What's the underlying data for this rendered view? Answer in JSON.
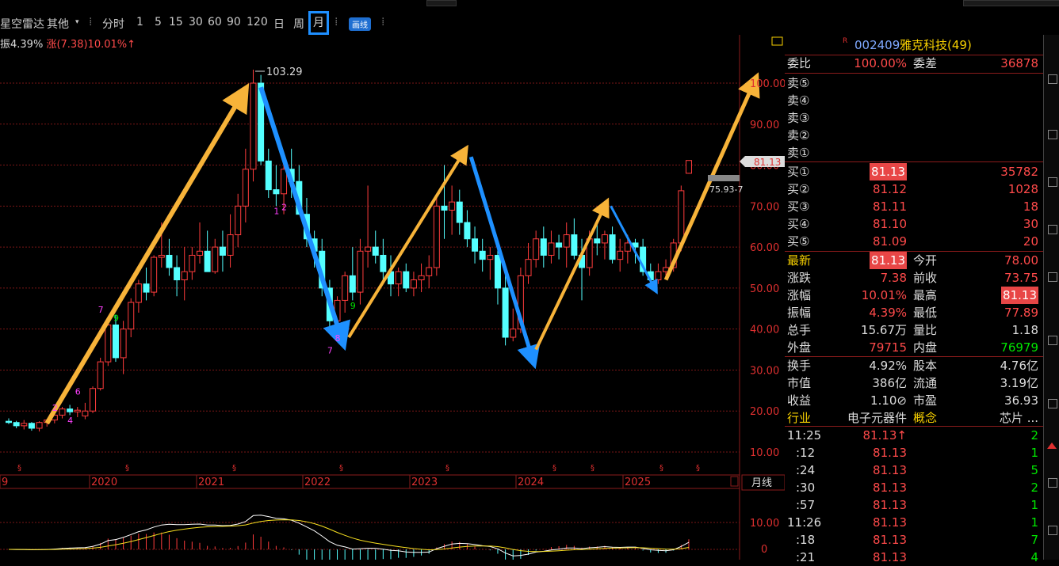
{
  "toolbar": {
    "radar": "星空雷达",
    "other": "其他",
    "timeframes": [
      "分时",
      "1",
      "5",
      "15",
      "30",
      "60",
      "90",
      "120",
      "日",
      "周",
      "月"
    ],
    "selected_timeframe": "月",
    "draw_button": "画线"
  },
  "info_line": {
    "amplitude": "振4.39%",
    "change": "涨(7.38)10.01%↑"
  },
  "stock": {
    "code": "002409",
    "name": "雅克科技(49)",
    "flag": "R"
  },
  "entrust": {
    "ratio_label": "委比",
    "ratio": "100.00%",
    "diff_label": "委差",
    "diff": "36878"
  },
  "sell_levels": [
    "卖⑤",
    "卖④",
    "卖③",
    "卖②",
    "卖①"
  ],
  "buy_levels": [
    {
      "label": "买①",
      "price": "81.13",
      "vol": "35782"
    },
    {
      "label": "买②",
      "price": "81.12",
      "vol": "1028"
    },
    {
      "label": "买③",
      "price": "81.11",
      "vol": "18"
    },
    {
      "label": "买④",
      "price": "81.10",
      "vol": "30"
    },
    {
      "label": "买⑤",
      "price": "81.09",
      "vol": "20"
    }
  ],
  "quote": [
    {
      "l": "最新",
      "v": "81.13",
      "n": "今开",
      "r": "78.00"
    },
    {
      "l": "涨跌",
      "v": "7.38",
      "n": "前收",
      "r": "73.75"
    },
    {
      "l": "涨幅",
      "v": "10.01%",
      "n": "最高",
      "r": "81.13"
    },
    {
      "l": "振幅",
      "v": "4.39%",
      "n": "最低",
      "r": "77.89"
    },
    {
      "l": "总手",
      "v": "15.67万",
      "n": "量比",
      "r": "1.18"
    },
    {
      "l": "外盘",
      "v": "79715",
      "n": "内盘",
      "r": "76979"
    }
  ],
  "fundamentals": [
    {
      "l": "换手",
      "v": "4.92%",
      "n": "股本",
      "r": "4.76亿"
    },
    {
      "l": "市值",
      "v": "386亿",
      "n": "流通",
      "r": "3.19亿"
    },
    {
      "l": "收益",
      "v": "1.10⊘",
      "n": "市盈",
      "r": "36.93"
    },
    {
      "l": "行业",
      "v": "电子元器件",
      "n": "概念",
      "r": "芯片 ..."
    }
  ],
  "ticks": [
    {
      "t": "11:25",
      "p": "81.13↑",
      "v": "2"
    },
    {
      "t": ":12",
      "p": "81.13",
      "v": "1"
    },
    {
      "t": ":24",
      "p": "81.13",
      "v": "5"
    },
    {
      "t": ":30",
      "p": "81.13",
      "v": "2"
    },
    {
      "t": ":57",
      "p": "81.13",
      "v": "1"
    },
    {
      "t": "11:26",
      "p": "81.13",
      "v": "1"
    },
    {
      "t": ":18",
      "p": "81.13",
      "v": "7"
    },
    {
      "t": ":21",
      "p": "81.13",
      "v": "4"
    }
  ],
  "chart_data": {
    "type": "candlestick",
    "price_axis": [
      "100.00",
      "90.00",
      "80.00",
      "70.00",
      "60.00",
      "50.00",
      "40.00",
      "30.00",
      "20.00",
      "10.00"
    ],
    "price_range": [
      5,
      108
    ],
    "years": [
      "9",
      "2020",
      "2021",
      "2022",
      "2023",
      "2024",
      "2025"
    ],
    "annotations": {
      "high_label": "103.29",
      "last_price_tag": "81.13",
      "ma_tag": "75.93-7"
    },
    "period_label": "月线",
    "macd_axis": [
      "10.00",
      "0"
    ],
    "tags": [
      "7",
      "9",
      "1",
      "2",
      "7",
      "8",
      "9",
      "6",
      "2",
      "4"
    ],
    "candles": [
      [
        17.5,
        18.2,
        16.8,
        17.2
      ],
      [
        17.2,
        17.6,
        15.8,
        16.4
      ],
      [
        16.4,
        17.8,
        15.5,
        17.0
      ],
      [
        17.0,
        17.3,
        15.2,
        15.8
      ],
      [
        15.8,
        17.5,
        15.0,
        17.2
      ],
      [
        17.2,
        18.0,
        16.2,
        17.8
      ],
      [
        17.8,
        19.5,
        17.0,
        19.0
      ],
      [
        19.0,
        21.0,
        18.2,
        20.5
      ],
      [
        20.5,
        21.5,
        19.0,
        19.8
      ],
      [
        19.8,
        21.0,
        18.5,
        20.2
      ],
      [
        18.8,
        22.0,
        18.0,
        20.0
      ],
      [
        20.0,
        26.0,
        19.5,
        25.5
      ],
      [
        25.5,
        33.0,
        25.0,
        32.0
      ],
      [
        32.0,
        42.0,
        31.0,
        41.0
      ],
      [
        41.0,
        43.5,
        32.0,
        33.0
      ],
      [
        33.0,
        42.0,
        29.0,
        40.0
      ],
      [
        40.0,
        47.5,
        38.0,
        46.5
      ],
      [
        46.5,
        52.0,
        44.0,
        51.0
      ],
      [
        51.0,
        55.0,
        47.0,
        49.0
      ],
      [
        49.0,
        58.0,
        48.0,
        57.5
      ],
      [
        57.5,
        66.0,
        55.0,
        58.0
      ],
      [
        58.0,
        62.0,
        53.0,
        55.0
      ],
      [
        55.0,
        58.0,
        48.0,
        52.0
      ],
      [
        52.0,
        60.0,
        47.0,
        54.0
      ],
      [
        54.0,
        60.0,
        52.0,
        58.0
      ],
      [
        58.0,
        66.0,
        56.0,
        59.0
      ],
      [
        59.0,
        64.0,
        55.0,
        54.0
      ],
      [
        54.0,
        62.0,
        53.5,
        60.0
      ],
      [
        60.0,
        64.0,
        54.0,
        58.0
      ],
      [
        58.0,
        68.0,
        55.0,
        63.0
      ],
      [
        63.0,
        73.0,
        60.0,
        70.0
      ],
      [
        70.0,
        84.0,
        66.0,
        79.0
      ],
      [
        79.0,
        103.29,
        76.0,
        100.0
      ],
      [
        100.0,
        102.0,
        80.0,
        81.0
      ],
      [
        81.0,
        84.0,
        72.0,
        74.0
      ],
      [
        74.0,
        80.0,
        70.0,
        73.0
      ],
      [
        73.0,
        82.0,
        68.0,
        79.0
      ],
      [
        79.0,
        84.0,
        72.0,
        76.0
      ],
      [
        76.0,
        80.0,
        68.0,
        68.0
      ],
      [
        68.0,
        72.0,
        60.0,
        62.0
      ],
      [
        62.0,
        64.0,
        55.0,
        59.0
      ],
      [
        59.0,
        62.0,
        48.0,
        50.0
      ],
      [
        50.0,
        52.0,
        40.0,
        42.0
      ],
      [
        42.0,
        48.0,
        39.0,
        47.0
      ],
      [
        47.0,
        54.0,
        44.0,
        53.0
      ],
      [
        53.0,
        60.0,
        47.0,
        49.0
      ],
      [
        49.0,
        62.0,
        46.0,
        59.0
      ],
      [
        59.0,
        75.0,
        55.0,
        60.0
      ],
      [
        60.0,
        64.0,
        56.0,
        58.0
      ],
      [
        58.0,
        62.0,
        52.0,
        54.0
      ],
      [
        54.0,
        58.0,
        48.0,
        51.0
      ],
      [
        51.0,
        55.0,
        48.0,
        54.0
      ],
      [
        54.0,
        56.0,
        49.0,
        50.0
      ],
      [
        50.0,
        54.0,
        48.0,
        52.0
      ],
      [
        52.0,
        56.0,
        49.0,
        53.0
      ],
      [
        53.0,
        58.0,
        50.0,
        55.0
      ],
      [
        55.0,
        72.0,
        53.0,
        70.0
      ],
      [
        70.0,
        80.0,
        62.0,
        69.0
      ],
      [
        69.0,
        75.0,
        63.0,
        71.0
      ],
      [
        71.0,
        74.0,
        63.0,
        66.0
      ],
      [
        66.0,
        69.0,
        60.0,
        62.0
      ],
      [
        62.0,
        65.0,
        56.0,
        59.0
      ],
      [
        59.0,
        62.0,
        54.0,
        57.0
      ],
      [
        57.0,
        60.0,
        52.0,
        58.0
      ],
      [
        58.0,
        60.0,
        46.0,
        50.0
      ],
      [
        50.0,
        54.0,
        36.0,
        38.0
      ],
      [
        38.0,
        45.0,
        37.0,
        40.0
      ],
      [
        40.0,
        55.0,
        39.0,
        53.0
      ],
      [
        53.0,
        61.0,
        51.0,
        57.0
      ],
      [
        57.0,
        64.0,
        55.0,
        62.0
      ],
      [
        62.0,
        65.0,
        55.0,
        58.0
      ],
      [
        58.0,
        64.0,
        56.0,
        61.0
      ],
      [
        61.0,
        63.0,
        57.0,
        60.0
      ],
      [
        60.0,
        66.0,
        55.0,
        63.0
      ],
      [
        63.0,
        67.0,
        57.0,
        58.0
      ],
      [
        58.0,
        62.0,
        47.0,
        55.0
      ],
      [
        55.0,
        64.0,
        53.0,
        62.0
      ],
      [
        62.0,
        66.0,
        58.0,
        61.0
      ],
      [
        61.0,
        64.0,
        57.0,
        63.0
      ],
      [
        63.0,
        65.0,
        56.0,
        57.0
      ],
      [
        57.0,
        62.0,
        54.0,
        59.0
      ],
      [
        59.0,
        63.0,
        56.0,
        61.0
      ],
      [
        61.0,
        62.0,
        56.0,
        60.0
      ],
      [
        60.0,
        62.0,
        53.0,
        54.0
      ],
      [
        54.0,
        56.0,
        51.0,
        52.0
      ],
      [
        52.0,
        56.0,
        51.0,
        54.0
      ],
      [
        54.0,
        57.0,
        53.0,
        55.0
      ],
      [
        55.0,
        62.0,
        54.0,
        61.0
      ],
      [
        61.0,
        75.0,
        59.0,
        73.75
      ],
      [
        78.0,
        81.13,
        77.89,
        81.13
      ]
    ]
  }
}
